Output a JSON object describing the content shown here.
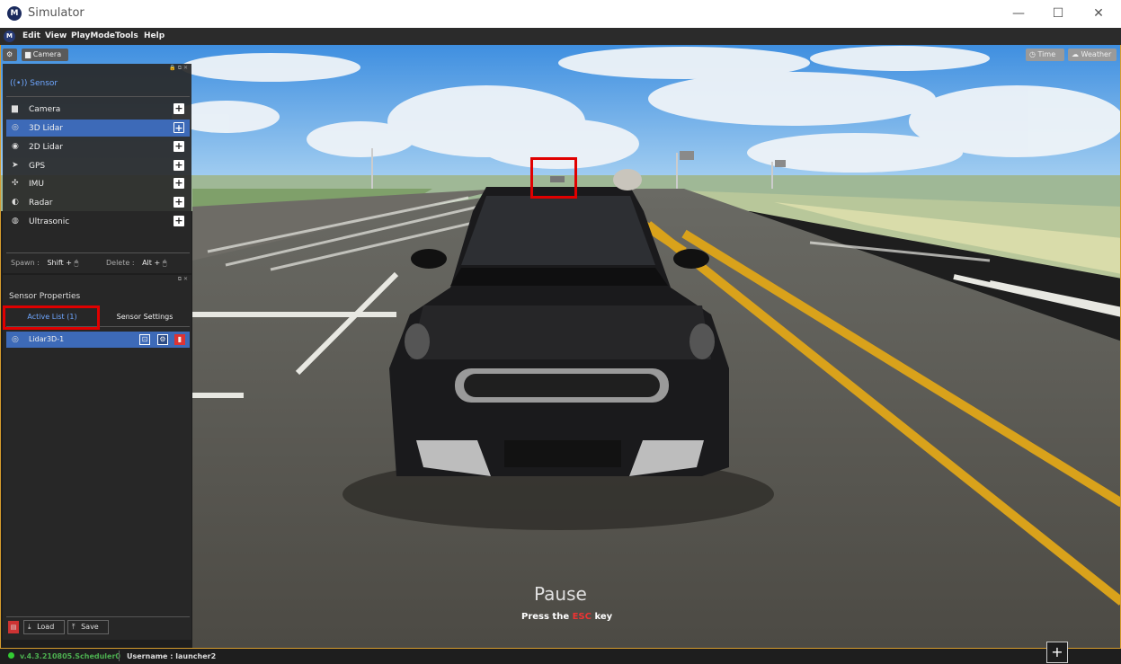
{
  "window": {
    "title": "Simulator",
    "controls": [
      "—",
      "☐",
      "✕"
    ]
  },
  "menu": {
    "logo": "M",
    "items": [
      "Edit",
      "View",
      "PlayMode",
      "Tools",
      "Help"
    ]
  },
  "top_toolbar": {
    "camera_label": "Camera",
    "time_label": "Time",
    "weather_label": "Weather"
  },
  "sensor_panel": {
    "title": "Sensor",
    "items": [
      {
        "label": "Camera",
        "icon": "camera-icon",
        "selected": false
      },
      {
        "label": "3D Lidar",
        "icon": "lidar3d-icon",
        "selected": true
      },
      {
        "label": "2D Lidar",
        "icon": "lidar2d-icon",
        "selected": false
      },
      {
        "label": "GPS",
        "icon": "gps-icon",
        "selected": false
      },
      {
        "label": "IMU",
        "icon": "imu-icon",
        "selected": false
      },
      {
        "label": "Radar",
        "icon": "radar-icon",
        "selected": false
      },
      {
        "label": "Ultrasonic",
        "icon": "ultrasonic-icon",
        "selected": false
      }
    ],
    "spawn_label": "Spawn :",
    "spawn_key": "Shift +",
    "delete_label": "Delete :",
    "delete_key": "Alt +"
  },
  "properties_panel": {
    "title": "Sensor Properties",
    "tabs": [
      "Active List (1)",
      "Sensor Settings"
    ],
    "active_items": [
      {
        "label": "Lidar3D-1"
      }
    ],
    "load_label": "Load",
    "save_label": "Save"
  },
  "overlay": {
    "pause_text": "Pause",
    "press_prefix": "Press the ",
    "esc_key": "ESC",
    "press_suffix": " key"
  },
  "status": {
    "version": "v.4.3.210805.Scheduler0",
    "username": "Username : launcher2"
  },
  "colors": {
    "accent": "#3d6ab8",
    "highlight": "#e00000",
    "road_line": "#d9a21b"
  }
}
